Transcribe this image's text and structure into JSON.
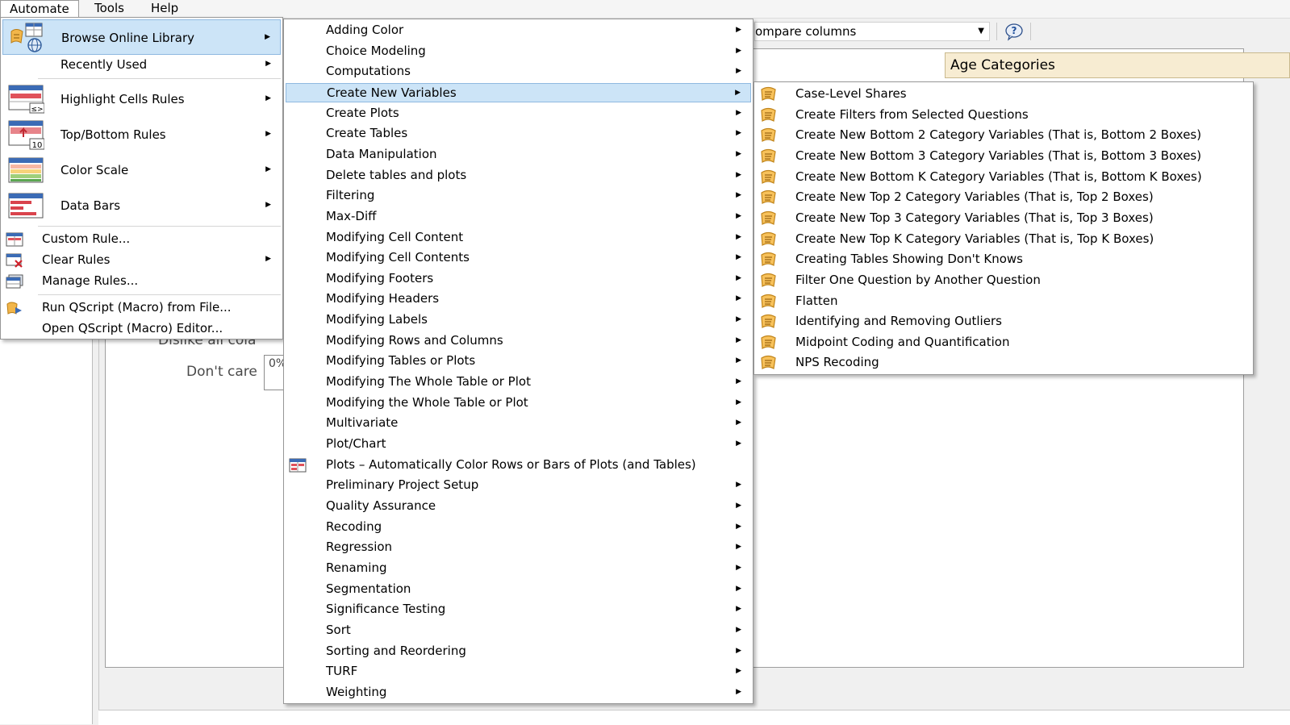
{
  "menubar": {
    "items": [
      "Automate",
      "Tools",
      "Help"
    ]
  },
  "toolbar": {
    "combo_value": "ompare columns",
    "help_icon": "help-icon"
  },
  "table": {
    "header": "Age Categories",
    "row_dislike": "Dislike all cola",
    "row_dont_care": "Don't care",
    "pct": "0%"
  },
  "automate_menu": {
    "items": [
      {
        "label": "Browse Online Library",
        "icon": "online-library-icon",
        "submenu": true
      },
      {
        "label": "Recently Used",
        "submenu": true
      },
      {
        "label": "Highlight Cells Rules",
        "icon": "highlight-cells-icon",
        "submenu": true
      },
      {
        "label": "Top/Bottom Rules",
        "icon": "top-bottom-icon",
        "submenu": true
      },
      {
        "label": "Color Scale",
        "icon": "color-scale-icon",
        "submenu": true
      },
      {
        "label": "Data Bars",
        "icon": "data-bars-icon",
        "submenu": true
      },
      {
        "label": "Custom Rule...",
        "icon": "custom-rule-icon",
        "submenu": false
      },
      {
        "label": "Clear Rules",
        "icon": "clear-rules-icon",
        "submenu": true
      },
      {
        "label": "Manage Rules...",
        "icon": "manage-rules-icon",
        "submenu": false
      },
      {
        "label": "Run QScript (Macro) from File...",
        "icon": "qscript-icon",
        "submenu": false
      },
      {
        "label": "Open QScript (Macro) Editor...",
        "submenu": false
      }
    ]
  },
  "library_menu": {
    "items": [
      "Adding Color",
      "Choice Modeling",
      "Computations",
      "Create New Variables",
      "Create Plots",
      "Create Tables",
      "Data Manipulation",
      "Delete tables and plots",
      "Filtering",
      "Max-Diff",
      "Modifying Cell Content",
      "Modifying Cell Contents",
      "Modifying Footers",
      "Modifying Headers",
      "Modifying Labels",
      "Modifying Rows and Columns",
      "Modifying Tables or Plots",
      "Modifying The Whole Table or Plot",
      "Modifying the Whole Table or Plot",
      "Multivariate",
      "Plot/Chart",
      "Plots – Automatically Color Rows or Bars of Plots (and Tables)",
      "Preliminary Project Setup",
      "Quality Assurance",
      "Recoding",
      "Regression",
      "Renaming",
      "Segmentation",
      "Significance Testing",
      "Sort",
      "Sorting and Reordering",
      "TURF",
      "Weighting"
    ],
    "highlighted": "Create New Variables",
    "no_arrow_item": "Plots – Automatically Color Rows or Bars of Plots (and Tables)"
  },
  "variables_menu": {
    "items": [
      "Case-Level Shares",
      "Create Filters from Selected Questions",
      "Create New Bottom 2 Category Variables (That is, Bottom 2 Boxes)",
      "Create New Bottom 3 Category Variables (That is, Bottom 3 Boxes)",
      "Create New Bottom K Category Variables (That is, Bottom K Boxes)",
      "Create New Top 2 Category Variables (That is, Top 2 Boxes)",
      "Create New Top 3 Category Variables (That is, Top 3 Boxes)",
      "Create New Top K Category Variables (That is, Top K Boxes)",
      "Creating Tables Showing Don't Knows",
      "Filter One Question by Another Question",
      "Flatten",
      "Identifying and Removing Outliers",
      "Midpoint Coding and Quantification",
      "NPS Recoding"
    ],
    "icon": "script-scroll-icon"
  },
  "colors": {
    "highlight": "#cce4f7",
    "highlight_border": "#8fb9e0",
    "header_bg": "#f7ecd2"
  }
}
